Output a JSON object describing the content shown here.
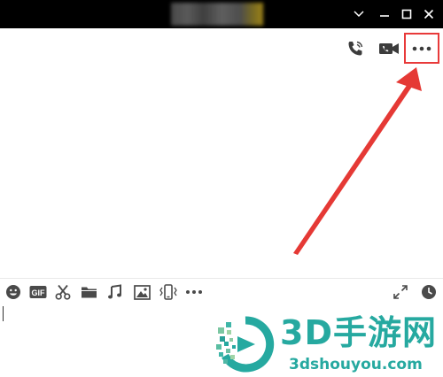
{
  "titlebar": {
    "icons": [
      "chevron-down-icon",
      "minimize-icon",
      "maximize-icon",
      "close-icon"
    ],
    "background": "#000000"
  },
  "header": {
    "icons": [
      "voice-call-icon",
      "video-call-icon",
      "more-icon"
    ],
    "highlight_color": "#e83a3a"
  },
  "toolbar": {
    "left_icons": [
      "emoji-icon",
      "gif-icon",
      "scissors-icon",
      "folder-icon",
      "music-icon",
      "image-icon",
      "shake-icon",
      "more-tools-icon"
    ],
    "gif_label": "GIF",
    "right_icons": [
      "expand-icon",
      "history-clock-icon"
    ]
  },
  "watermark": {
    "title": "3D手游网",
    "url": "3dshouyou.com",
    "color": "#26a9a0"
  }
}
